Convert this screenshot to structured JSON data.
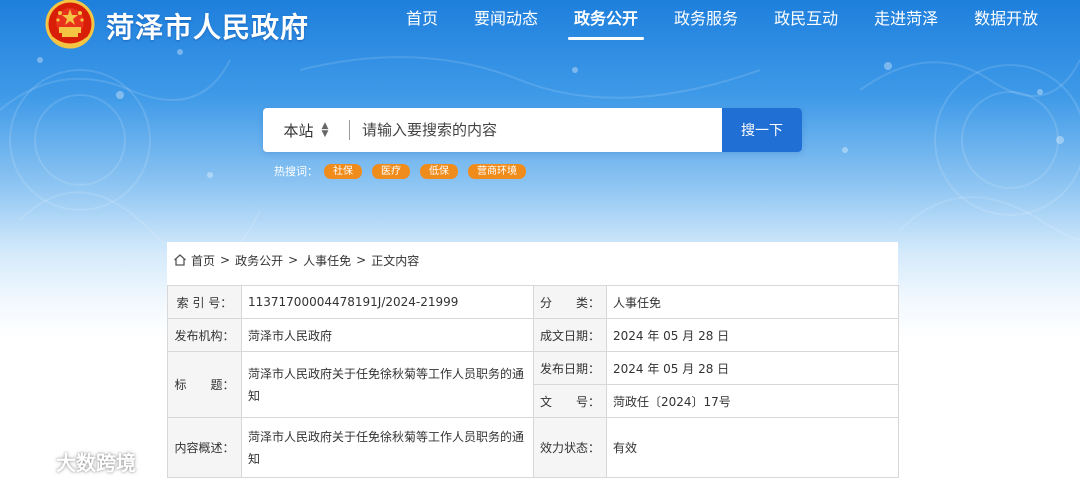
{
  "site": {
    "title": "菏泽市人民政府"
  },
  "nav": [
    {
      "label": "首页",
      "active": false
    },
    {
      "label": "要闻动态",
      "active": false
    },
    {
      "label": "政务公开",
      "active": true
    },
    {
      "label": "政务服务",
      "active": false
    },
    {
      "label": "政民互动",
      "active": false
    },
    {
      "label": "走进菏泽",
      "active": false
    },
    {
      "label": "数据开放",
      "active": false
    }
  ],
  "search": {
    "scope": "本站",
    "placeholder": "请输入要搜索的内容",
    "button": "搜一下"
  },
  "hot": {
    "label": "热搜词：",
    "tags": [
      "社保",
      "医疗",
      "低保",
      "营商环境"
    ]
  },
  "breadcrumb": [
    "首页",
    "政务公开",
    "人事任免",
    "正文内容"
  ],
  "meta": {
    "index_label": "索 引 号：",
    "index_value": "11371700004478191J/2024-21999",
    "category_label": "分　　类：",
    "category_value": "人事任免",
    "publisher_label": "发布机构：",
    "publisher_value": "菏泽市人民政府",
    "created_label": "成文日期：",
    "created_value": "2024 年 05 月 28 日",
    "title_label": "标　　题：",
    "title_value": "菏泽市人民政府关于任免徐秋菊等工作人员职务的通知",
    "published_label": "发布日期：",
    "published_value": "2024 年 05 月 28 日",
    "docno_label": "文　　号：",
    "docno_value": "菏政任〔2024〕17号",
    "summary_label": "内容概述：",
    "summary_value": "菏泽市人民政府关于任免徐秋菊等工作人员职务的通知",
    "status_label": "效力状态：",
    "status_value": "有效"
  },
  "watermark": {
    "text": "大数跨境"
  },
  "colors": {
    "header_blue": "#1e7fdc",
    "search_button": "#1f6fd4",
    "hot_tag": "#f08c1c",
    "label_bg": "#f5f5f5"
  },
  "icons": [
    "national-emblem-icon",
    "home-icon",
    "sort-arrows-icon",
    "watermark-logo-icon"
  ]
}
